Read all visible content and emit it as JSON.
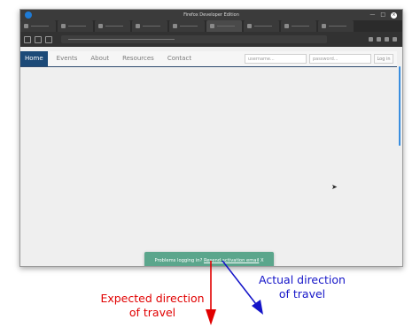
{
  "window": {
    "title": "Firefox Developer Edition",
    "controls": [
      "—",
      "□",
      "×"
    ]
  },
  "site_nav": {
    "items": [
      "Home",
      "Events",
      "About",
      "Resources",
      "Contact"
    ],
    "active_index": 0
  },
  "login": {
    "username_placeholder": "username...",
    "password_placeholder": "password...",
    "button_label": "Log in"
  },
  "toast": {
    "prefix": "Problems logging in? ",
    "link_text": "Resend activation email",
    "close_glyph": "X"
  },
  "annotations": {
    "expected_line1": "Expected direction",
    "expected_line2": "of travel",
    "expected_color": "#e10000",
    "actual_line1": "Actual direction",
    "actual_line2": "of travel",
    "actual_color": "#1414c8"
  },
  "colors": {
    "nav_active_bg": "#1c4a78",
    "toast_bg": "#5ba68c",
    "scrollbar": "#3a8ee0"
  }
}
